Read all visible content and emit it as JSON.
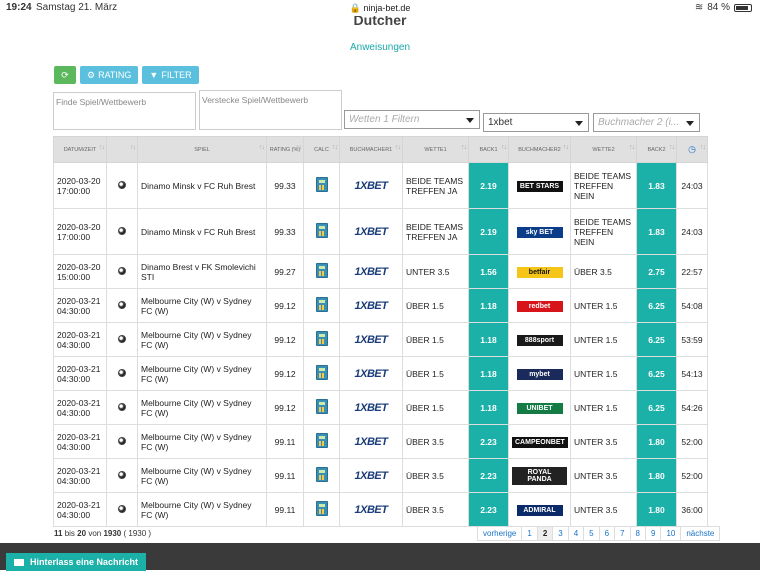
{
  "statusbar": {
    "time": "19:24",
    "date": "Samstag 21. März",
    "url": "ninja-bet.de",
    "battery": "84 %"
  },
  "header": {
    "title": "Dutcher",
    "link": "Anweisungen"
  },
  "toolbar": {
    "rating_label": "RATING",
    "filter_label": "FILTER"
  },
  "search": {
    "game_placeholder": "Finde Spiel/Wettbewerb",
    "hide_placeholder": "Verstecke Spiel/Wettbewerb"
  },
  "selects": {
    "bets_placeholder": "Wetten 1 Filtern",
    "bookmaker1": "1xbet",
    "bookmaker2_placeholder": "Buchmacher 2 (i..."
  },
  "table": {
    "headers": [
      "Datum/Zeit",
      "",
      "Spiel",
      "Rating (%)",
      "Calc",
      "Buchmacher1",
      "Wette1",
      "Back1",
      "Buchmacher2",
      "Wette2",
      "Back2",
      ""
    ],
    "rows": [
      {
        "date": "2020-03-20",
        "time": "17:00:00",
        "game": "Dinamo Minsk v FC Ruh Brest",
        "rating": "99.33",
        "bm1": "1XBET",
        "bet1": "BEIDE TEAMS TREFFEN JA",
        "back1": "2.19",
        "bm2": "BET STARS",
        "bm2_color": "#111111",
        "bet2": "BEIDE TEAMS TREFFEN NEIN",
        "back2": "1.83",
        "timer": "24:03"
      },
      {
        "date": "2020-03-20",
        "time": "17:00:00",
        "game": "Dinamo Minsk v FC Ruh Brest",
        "rating": "99.33",
        "bm1": "1XBET",
        "bet1": "BEIDE TEAMS TREFFEN JA",
        "back1": "2.19",
        "bm2": "sky BET",
        "bm2_color": "#0a3c8a",
        "bet2": "BEIDE TEAMS TREFFEN NEIN",
        "back2": "1.83",
        "timer": "24:03"
      },
      {
        "date": "2020-03-20",
        "time": "15:00:00",
        "game": "Dinamo Brest v FK Smolevichi STI",
        "rating": "99.27",
        "bm1": "1XBET",
        "bet1": "UNTER 3.5",
        "back1": "1.56",
        "bm2": "betfair",
        "bm2_color": "#f5c518",
        "bet2": "ÜBER 3.5",
        "back2": "2.75",
        "timer": "22:57"
      },
      {
        "date": "2020-03-21",
        "time": "04:30:00",
        "game": "Melbourne City (W) v Sydney FC (W)",
        "rating": "99.12",
        "bm1": "1XBET",
        "bet1": "ÜBER 1.5",
        "back1": "1.18",
        "bm2": "redbet",
        "bm2_color": "#d7141a",
        "bet2": "UNTER 1.5",
        "back2": "6.25",
        "timer": "54:08"
      },
      {
        "date": "2020-03-21",
        "time": "04:30:00",
        "game": "Melbourne City (W) v Sydney FC (W)",
        "rating": "99.12",
        "bm1": "1XBET",
        "bet1": "ÜBER 1.5",
        "back1": "1.18",
        "bm2": "888sport",
        "bm2_color": "#1a1a1a",
        "bet2": "UNTER 1.5",
        "back2": "6.25",
        "timer": "53:59"
      },
      {
        "date": "2020-03-21",
        "time": "04:30:00",
        "game": "Melbourne City (W) v Sydney FC (W)",
        "rating": "99.12",
        "bm1": "1XBET",
        "bet1": "ÜBER 1.5",
        "back1": "1.18",
        "bm2": "mybet",
        "bm2_color": "#1a2a5a",
        "bet2": "UNTER 1.5",
        "back2": "6.25",
        "timer": "54:13"
      },
      {
        "date": "2020-03-21",
        "time": "04:30:00",
        "game": "Melbourne City (W) v Sydney FC (W)",
        "rating": "99.12",
        "bm1": "1XBET",
        "bet1": "ÜBER 1.5",
        "back1": "1.18",
        "bm2": "UNIBET",
        "bm2_color": "#147b45",
        "bet2": "UNTER 1.5",
        "back2": "6.25",
        "timer": "54:26"
      },
      {
        "date": "2020-03-21",
        "time": "04:30:00",
        "game": "Melbourne City (W) v Sydney FC (W)",
        "rating": "99.11",
        "bm1": "1XBET",
        "bet1": "ÜBER 3.5",
        "back1": "2.23",
        "bm2": "CAMPEONBET",
        "bm2_color": "#111111",
        "bet2": "UNTER 3.5",
        "back2": "1.80",
        "timer": "52:00"
      },
      {
        "date": "2020-03-21",
        "time": "04:30:00",
        "game": "Melbourne City (W) v Sydney FC (W)",
        "rating": "99.11",
        "bm1": "1XBET",
        "bet1": "ÜBER 3.5",
        "back1": "2.23",
        "bm2": "ROYAL PANDA",
        "bm2_color": "#222222",
        "bet2": "UNTER 3.5",
        "back2": "1.80",
        "timer": "52:00"
      },
      {
        "date": "2020-03-21",
        "time": "04:30:00",
        "game": "Melbourne City (W) v Sydney FC (W)",
        "rating": "99.11",
        "bm1": "1XBET",
        "bet1": "ÜBER 3.5",
        "back1": "2.23",
        "bm2": "ADMIRAL",
        "bm2_color": "#0a2a6a",
        "bet2": "UNTER 3.5",
        "back2": "1.80",
        "timer": "36:00"
      }
    ]
  },
  "footer": {
    "from": "11",
    "to": "20",
    "total": "1930",
    "total_paren": "( 1930 )",
    "bis": "bis",
    "von": "von"
  },
  "pager": [
    "vorherige",
    "1",
    "2",
    "3",
    "4",
    "5",
    "6",
    "7",
    "8",
    "9",
    "10",
    "nächste"
  ],
  "pager_active": "2",
  "chat": {
    "label": "Hinterlass eine Nachricht"
  }
}
